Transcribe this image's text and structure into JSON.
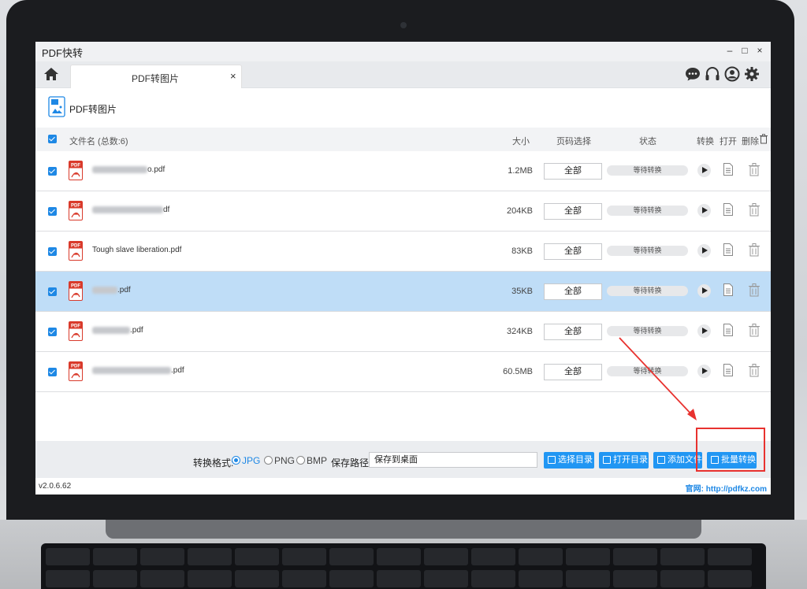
{
  "window": {
    "title": "PDF快转",
    "minimize": "–",
    "maximize": "□",
    "close": "×"
  },
  "tab": {
    "label": "PDF转图片",
    "close": "×"
  },
  "toolbar_icons": [
    "chat-icon",
    "headset-icon",
    "user-icon",
    "settings-icon"
  ],
  "page": {
    "title": "PDF转图片"
  },
  "table": {
    "columns": {
      "name": "文件名 (总数:6)",
      "size": "大小",
      "pages": "页码选择",
      "status": "状态",
      "convert": "转换",
      "open": "打开",
      "delete": "删除"
    },
    "rows": [
      {
        "name_suffix": "o.pdf",
        "name": "",
        "size": "1.2MB",
        "pages": "全部",
        "status": "等待转换",
        "selected": false
      },
      {
        "name_suffix": "df",
        "name": "",
        "size": "204KB",
        "pages": "全部",
        "status": "等待转换",
        "selected": false
      },
      {
        "name_suffix": "",
        "name": "Tough slave liberation.pdf",
        "size": "83KB",
        "pages": "全部",
        "status": "等待转换",
        "selected": false
      },
      {
        "name_suffix": ".pdf",
        "name": "",
        "size": "35KB",
        "pages": "全部",
        "status": "等待转换",
        "selected": true
      },
      {
        "name_suffix": ".pdf",
        "name": "",
        "size": "324KB",
        "pages": "全部",
        "status": "等待转换",
        "selected": false
      },
      {
        "name_suffix": ".pdf",
        "name": "",
        "size": "60.5MB",
        "pages": "全部",
        "status": "等待转换",
        "selected": false
      }
    ]
  },
  "bottom": {
    "format_label": "转换格式:",
    "formats": [
      {
        "label": "JPG",
        "selected": true
      },
      {
        "label": "PNG",
        "selected": false
      },
      {
        "label": "BMP",
        "selected": false
      }
    ],
    "path_label": "保存路径:",
    "path_value": "保存到桌面",
    "buttons": {
      "choose_dir": "选择目录",
      "open_dir": "打开目录",
      "add_file": "添加文件",
      "batch_convert": "批量转换"
    }
  },
  "statusbar": {
    "version": "v2.0.6.62",
    "site": "官网: http://pdfkz.com"
  },
  "colors": {
    "accent": "#2196f3",
    "selected_row": "#bfddf7",
    "annotation": "#e8322f",
    "pdf_icon": "#d93a2b"
  }
}
